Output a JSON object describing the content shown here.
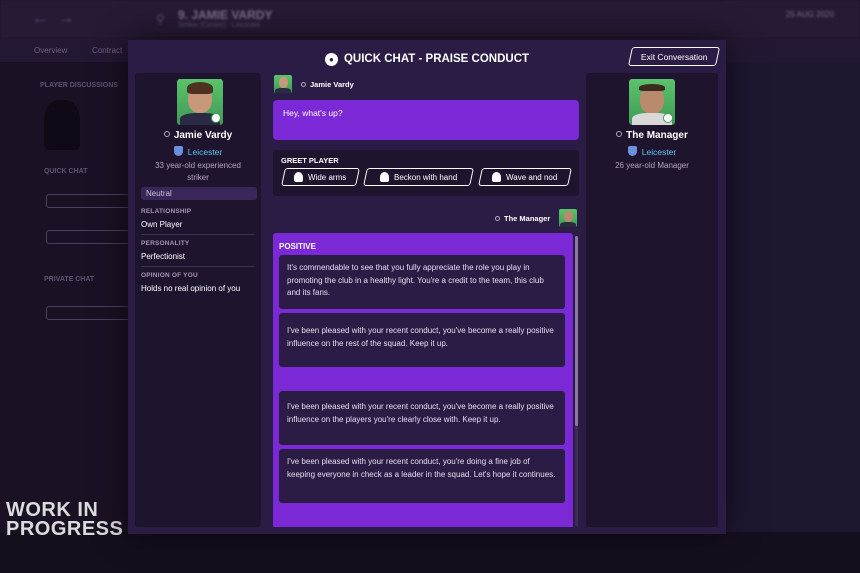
{
  "background": {
    "header_title": "9. JAMIE VARDY",
    "header_sub": "Striker (Centre) · Leicester",
    "date": "25 AUG 2020",
    "tabs": [
      "Overview",
      "Contract"
    ],
    "left_section1": "PLAYER DISCUSSIONS",
    "left_section2": "QUICK CHAT",
    "left_section3": "PRIVATE CHAT"
  },
  "watermark": {
    "line1": "WORK IN",
    "line2": "PROGRESS"
  },
  "modal": {
    "title": "QUICK CHAT - PRAISE CONDUCT",
    "exit_label": "Exit Conversation"
  },
  "player": {
    "name": "Jamie Vardy",
    "club": "Leicester",
    "description": "33 year-old experienced striker",
    "mood": "Neutral",
    "relationship_label": "RELATIONSHIP",
    "relationship_value": "Own Player",
    "personality_label": "PERSONALITY",
    "personality_value": "Perfectionist",
    "opinion_label": "OPINION OF YOU",
    "opinion_value": "Holds no real opinion of you"
  },
  "manager": {
    "name": "The Manager",
    "club": "Leicester",
    "description": "26 year-old Manager"
  },
  "chat": {
    "speaker": "Jamie Vardy",
    "message": "Hey, what's up?",
    "reply_speaker": "The Manager"
  },
  "greet": {
    "label": "GREET PLAYER",
    "options": [
      "Wide arms",
      "Beckon with hand",
      "Wave and nod"
    ]
  },
  "responses": {
    "header": "POSITIVE",
    "items": [
      "It's commendable to see that you fully appreciate the role you play in promoting the club in a healthy light. You're a credit to the team, this club and its fans.",
      "I've been pleased with your recent conduct, you've become a really positive influence on the rest of the squad. Keep it up.",
      "I've been pleased with your recent conduct, you've become a really positive influence on the players you're clearly close with. Keep it up.",
      "I've been pleased with your recent conduct, you're doing a fine job of keeping everyone in check as a leader in the squad. Let's hope it continues."
    ]
  }
}
